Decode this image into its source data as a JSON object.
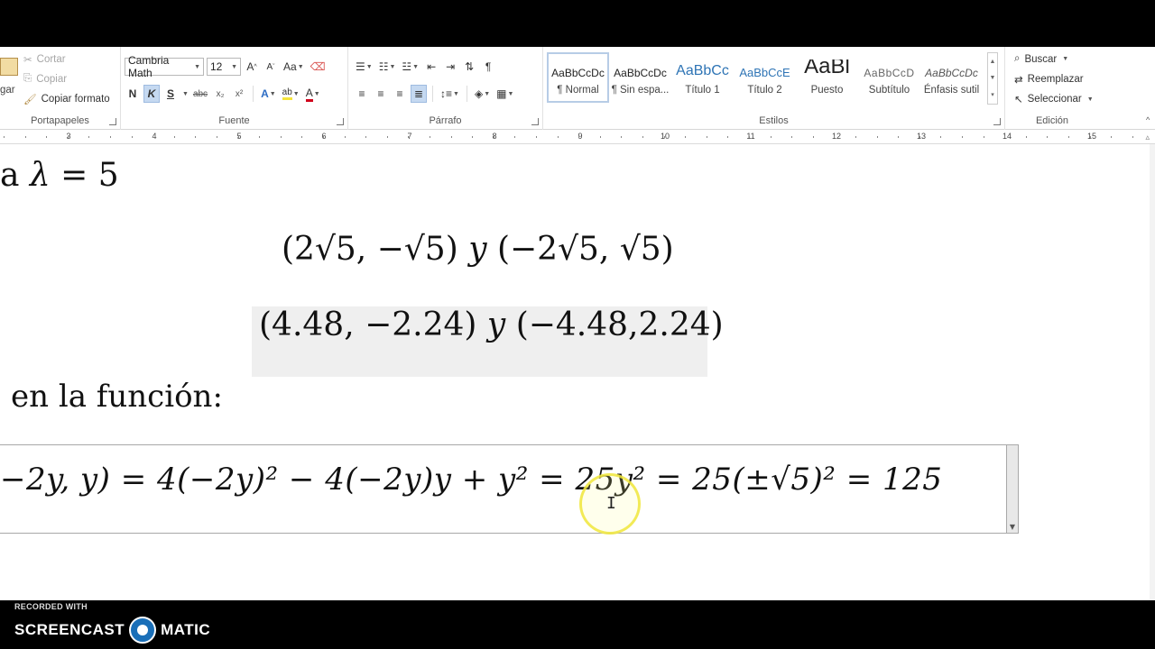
{
  "ribbon": {
    "clipboard": {
      "paste_label": "gar",
      "cut": "Cortar",
      "copy": "Copiar",
      "format_painter": "Copiar formato",
      "label": "Portapapeles"
    },
    "font": {
      "family": "Cambria Math",
      "size": "12",
      "grow": "A",
      "shrink": "A",
      "case": "Aa",
      "bold": "N",
      "italic": "K",
      "underline": "S",
      "strike": "abc",
      "subscript": "x₂",
      "superscript": "x²",
      "effects": "A",
      "highlight": "ab",
      "font_color": "A",
      "label": "Fuente"
    },
    "paragraph": {
      "pilcrow": "¶",
      "label": "Párrafo"
    },
    "styles": {
      "items": [
        {
          "sample": "AaBbCcDc",
          "name": "¶ Normal"
        },
        {
          "sample": "AaBbCcDc",
          "name": "¶ Sin espa..."
        },
        {
          "sample": "AaBbCc",
          "name": "Título 1"
        },
        {
          "sample": "AaBbCcE",
          "name": "Título 2"
        },
        {
          "sample": "AaBl",
          "name": "Puesto"
        },
        {
          "sample": "AaBbCcD",
          "name": "Subtítulo"
        },
        {
          "sample": "AaBbCcDc",
          "name": "Énfasis sutil"
        }
      ],
      "label": "Estilos"
    },
    "editing": {
      "find": "Buscar",
      "replace": "Reemplazar",
      "select": "Seleccionar",
      "label": "Edición"
    }
  },
  "ruler": {
    "ticks": [
      "3",
      "4",
      "5",
      "6",
      "7",
      "8",
      "9",
      "10",
      "11",
      "12",
      "13",
      "14",
      "15"
    ]
  },
  "document": {
    "line1_prefix": "a ",
    "line1_lambda": "λ",
    "line1_rest": " = 5",
    "eq_exact": {
      "open": "(2√5, −√5) ",
      "conj": "y",
      "close": " (−2√5, √5)"
    },
    "eq_numeric": {
      "open": "(4.48, −2.24) ",
      "conj": "y",
      "close": " (−4.48,2.24)"
    },
    "line3": "en la función:",
    "eq_function": "−2y, y) = 4(−2y)² − 4(−2y)y + y² = 25y² = 25(±√5)² = 125"
  },
  "watermark": {
    "recorded": "RECORDED WITH",
    "brand_left": "SCREENCAST",
    "brand_right": "MATIC"
  },
  "colors": {
    "accent": "#2b579a",
    "highlight_yellow": "#f5e43a",
    "font_red": "#d0021b"
  }
}
